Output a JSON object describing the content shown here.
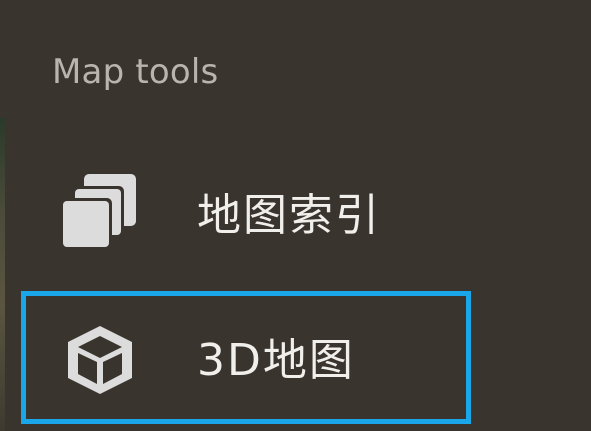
{
  "menu": {
    "title": "Map tools",
    "items": [
      {
        "label": "地图索引",
        "icon": "layers-stack-icon"
      },
      {
        "label": "3D地图",
        "icon": "cube-3d-icon"
      }
    ],
    "selected_item": "3D地图"
  },
  "colors": {
    "background": "#3a342f",
    "title_text": "#b9b4ae",
    "item_text": "#f1efec",
    "icon_fill": "#dcdcdc",
    "highlight_border": "#19a7ea"
  }
}
